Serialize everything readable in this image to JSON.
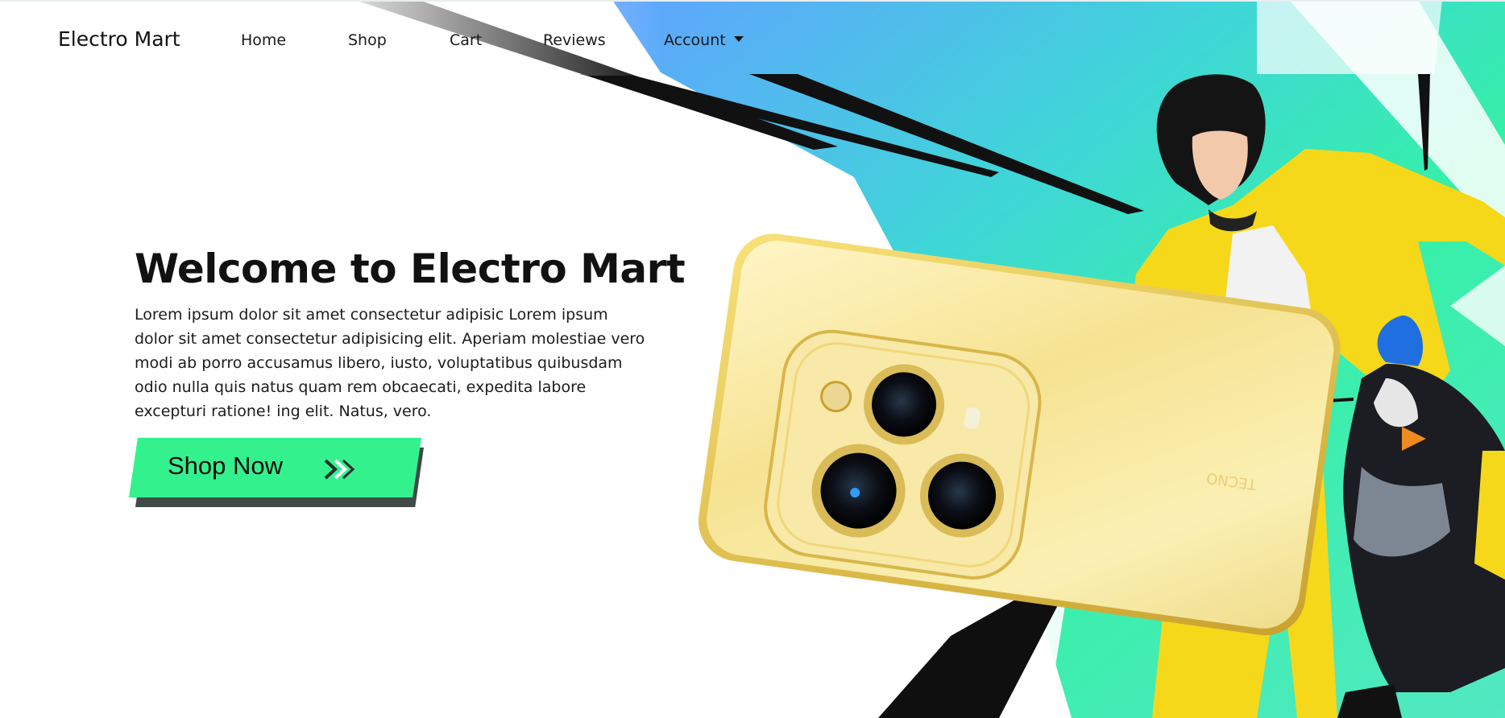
{
  "navbar": {
    "brand": "Electro Mart",
    "links": [
      {
        "label": "Home"
      },
      {
        "label": "Shop"
      },
      {
        "label": "Cart"
      },
      {
        "label": "Reviews"
      },
      {
        "label": "Account"
      }
    ]
  },
  "hero": {
    "title": "Welcome to Electro Mart",
    "text": "Lorem ipsum dolor sit amet consectetur adipisic Lorem ipsum dolor sit amet consectetur adipisicing elit. Aperiam molestiae vero modi ab porro accusamus libero, iusto, voluptatibus quibusdam odio nulla quis natus quam rem obcaecati, expedita labore excepturi ratione! ing elit. Natus, vero.",
    "cta_label": "Shop Now",
    "phone_logo": "TECNO"
  },
  "colors": {
    "accent_green": "#33f28d",
    "cta_shadow": "#3f4a46",
    "sky_blue": "#57aefb",
    "teal": "#3ce3b9",
    "phone_gold": "#f4e3a0",
    "jacket_yellow": "#f5d81a"
  },
  "icons": {
    "cta_arrows": "double-chevron-right-icon",
    "account_caret": "caret-down-icon"
  }
}
